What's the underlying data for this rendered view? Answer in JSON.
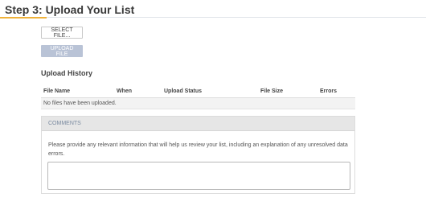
{
  "page": {
    "title": "Step 3: Upload Your List"
  },
  "actions": {
    "select_file_label": "SELECT FILE...",
    "upload_file_label": "UPLOAD FILE"
  },
  "upload_history": {
    "heading": "Upload History",
    "columns": [
      "File Name",
      "When",
      "Upload Status",
      "File Size",
      "Errors"
    ],
    "empty_message": "No files have been uploaded."
  },
  "comments": {
    "header": "COMMENTS",
    "help_text": "Please provide any relevant information that will help us review your list, including an explanation of any unresolved data errors.",
    "value": ""
  },
  "colors": {
    "accent": "#f0b23a",
    "disabled_button": "#b9c3d6",
    "panel_header": "#e6e6e6"
  },
  "icons": {
    "textarea_resize": "resize-grip-icon"
  }
}
